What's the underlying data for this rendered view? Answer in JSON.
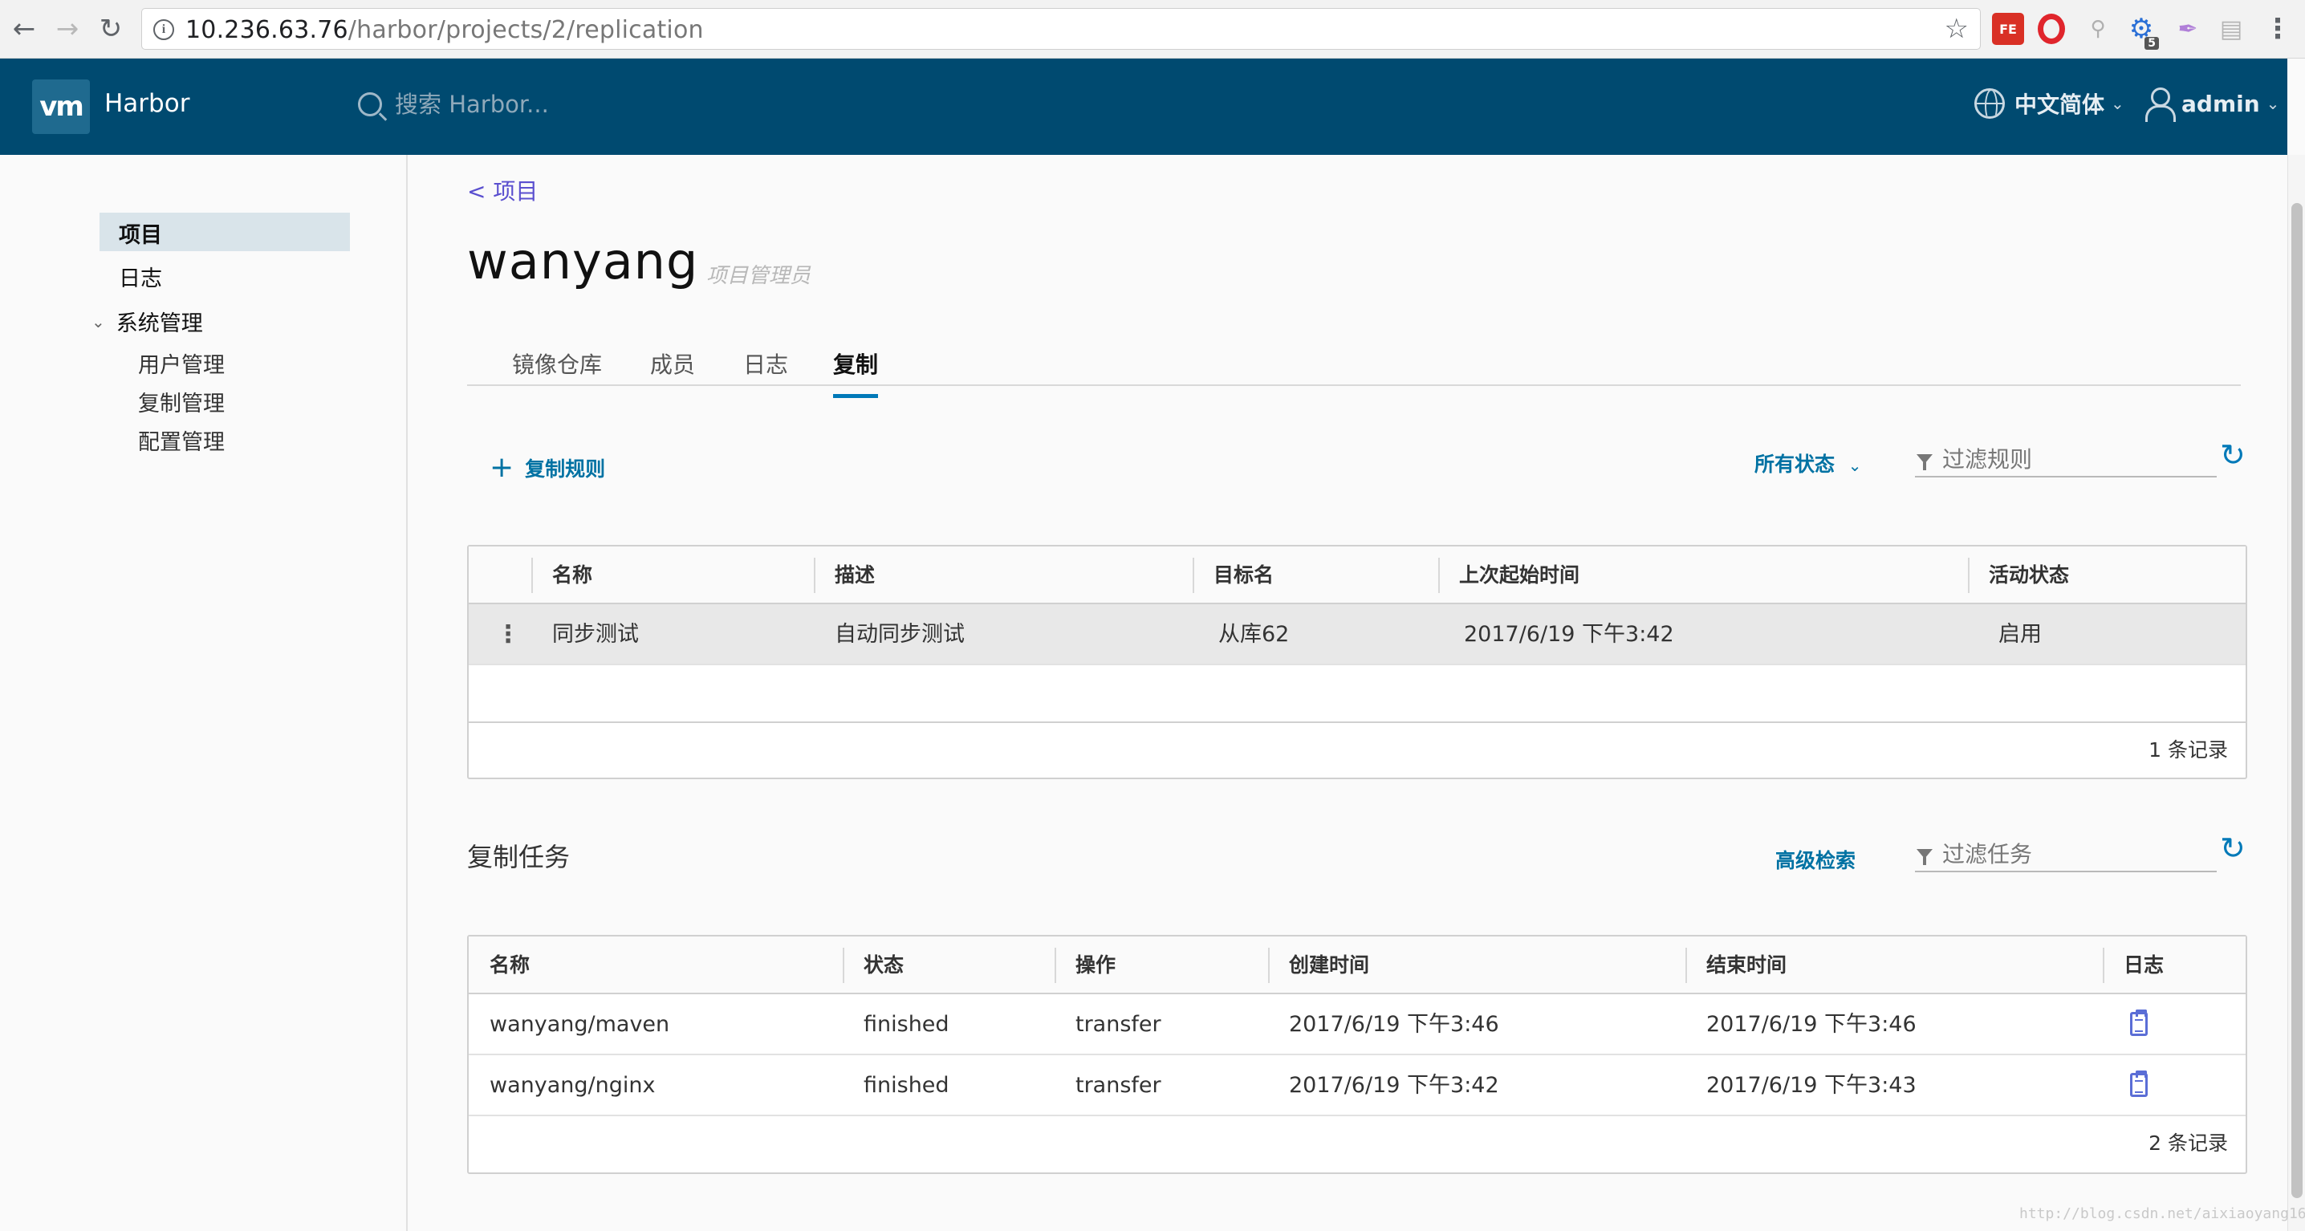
{
  "browser": {
    "url_host": "10.236.63.76",
    "url_path": "/harbor/projects/2/replication",
    "extension_badge": "5",
    "fe_label": "FE"
  },
  "header": {
    "logo": "vm",
    "app_name": "Harbor",
    "search_placeholder": "搜索 Harbor...",
    "language": "中文简体",
    "user": "admin"
  },
  "sidebar": {
    "items": [
      {
        "label": "项目",
        "active": true
      },
      {
        "label": "日志"
      },
      {
        "label": "系统管理"
      }
    ],
    "subitems": [
      "用户管理",
      "复制管理",
      "配置管理"
    ]
  },
  "main": {
    "back_link": "< 项目",
    "project_name": "wanyang",
    "project_role": "项目管理员",
    "tabs": [
      {
        "label": "镜像仓库"
      },
      {
        "label": "成员"
      },
      {
        "label": "日志"
      },
      {
        "label": "复制",
        "active": true
      }
    ],
    "rules": {
      "add_button": "复制规则",
      "status_filter": "所有状态",
      "filter_placeholder": "过滤规则",
      "columns": [
        "名称",
        "描述",
        "目标名",
        "上次起始时间",
        "活动状态"
      ],
      "rows": [
        [
          "同步测试",
          "自动同步测试",
          "从库62",
          "2017/6/19 下午3:42",
          "启用"
        ]
      ],
      "footer": "1 条记录"
    },
    "jobs": {
      "title": "复制任务",
      "advanced_search": "高级检索",
      "filter_placeholder": "过滤任务",
      "columns": [
        "名称",
        "状态",
        "操作",
        "创建时间",
        "结束时间",
        "日志"
      ],
      "rows": [
        [
          "wanyang/maven",
          "finished",
          "transfer",
          "2017/6/19 下午3:46",
          "2017/6/19 下午3:46"
        ],
        [
          "wanyang/nginx",
          "finished",
          "transfer",
          "2017/6/19 下午3:42",
          "2017/6/19 下午3:43"
        ]
      ],
      "footer": "2 条记录"
    }
  },
  "watermark": "http://blog.csdn.net/aixiaoyang168",
  "colors": {
    "header_bg": "#004a70",
    "accent": "#0079b8",
    "link": "#0072a3",
    "sidebar_active": "#d9e4ea"
  },
  "icons": [
    "back-arrow-icon",
    "forward-arrow-icon",
    "reload-icon",
    "info-icon",
    "star-icon",
    "search-icon",
    "globe-icon",
    "user-icon",
    "plus-icon",
    "filter-icon",
    "refresh-icon",
    "kebab-icon",
    "log-icon"
  ]
}
